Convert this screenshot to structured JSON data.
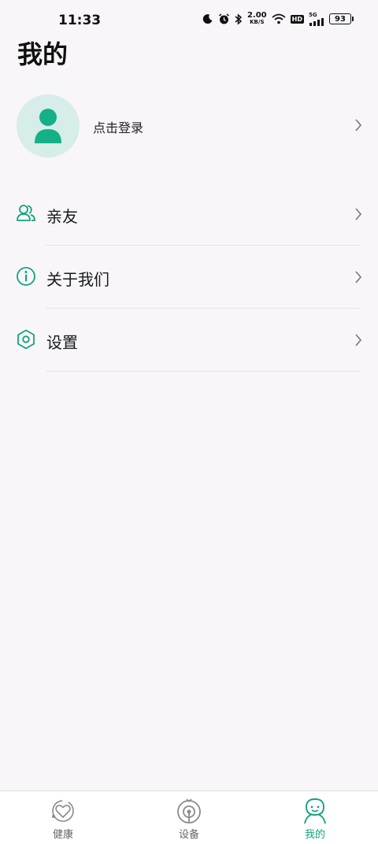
{
  "status_bar": {
    "time": "11:33",
    "net_speed_value": "2.00",
    "net_speed_unit": "KB/S",
    "hd_label": "HD",
    "signal_label": "5G",
    "battery": "93"
  },
  "page": {
    "title": "我的"
  },
  "profile": {
    "login_label": "点击登录"
  },
  "menu": {
    "items": [
      {
        "label": "亲友",
        "icon": "friends-icon"
      },
      {
        "label": "关于我们",
        "icon": "info-icon"
      },
      {
        "label": "设置",
        "icon": "settings-hex-icon"
      }
    ]
  },
  "bottom_nav": {
    "tabs": [
      {
        "label": "健康",
        "icon": "health-icon",
        "active": false
      },
      {
        "label": "设备",
        "icon": "device-icon",
        "active": false
      },
      {
        "label": "我的",
        "icon": "mine-icon",
        "active": true
      }
    ]
  },
  "colors": {
    "accent": "#14a27f",
    "avatar_bg": "#d6ede9",
    "background": "#f8f6f9"
  }
}
